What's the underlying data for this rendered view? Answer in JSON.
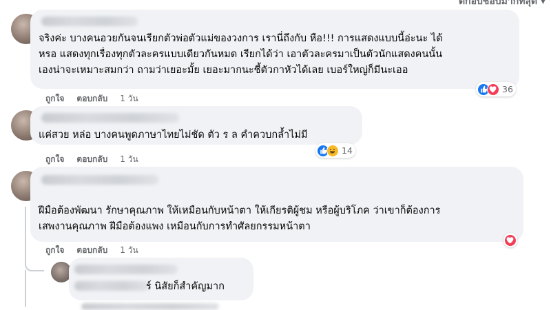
{
  "sort_label": "ตกอบชอบมากที่สุด ▾",
  "comments": [
    {
      "text": "จริงค่ะ บางคนอวยกันจนเรียกตัวพ่อตัวแม่ของวงการ เรานี่ถึงกับ หือ!!! การแสดงแบบนี้อ่ะนะ ได้\nหรอ แสดงทุกเรื่องทุกตัวละครแบบเดียวกันหมด เรียกได้ว่า เอาตัวละครมาเป็นตัวนักแสดงคนนั้น\nเองน่าจะเหมาะสมกว่า ถามว่าเยอะมั้ย เยอะมากนะชี้ตัวกาหัวได้เลย เบอร์ใหญ่ก็มีนะเออ",
      "like_label": "ถูกใจ",
      "reply_label": "ตอบกลับ",
      "time": "1 วัน",
      "reaction_count": "36"
    },
    {
      "text": "แค่สวย หล่อ บางคนพูดภาษาไทยไม่ชัด ตัว ร ล คำควบกล้ำไม่มี",
      "like_label": "ถูกใจ",
      "reply_label": "ตอบกลับ",
      "time": "1 วัน",
      "reaction_count": "14"
    },
    {
      "text": "ฝีมือต้องพัฒนา รักษาคุณภาพ ให้เหมือนกับหน้าตา ให้เกียรติผู้ชม หรือผู้บริโภค ว่าเขาก็ต้องการ\nเสพงานคุณภาพ ฝีมือต้องแพง เหมือนกับการทำศัลยกรรมหน้าตา",
      "like_label": "ถูกใจ",
      "reply_label": "ตอบกลับ",
      "time": "1 วัน"
    }
  ],
  "reply": {
    "text": "ร์ นิสัยก็สำคัญมาก"
  },
  "colors": {
    "like": "#1877f2",
    "love": "#f33e58",
    "haha": "#f7b928",
    "bubble": "#f0f2f5",
    "meta": "#65676b"
  }
}
